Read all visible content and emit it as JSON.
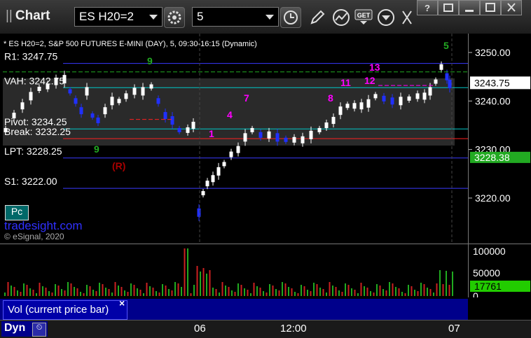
{
  "toolbar": {
    "app_title": "Chart",
    "symbol": "ES H20=2",
    "interval": "5"
  },
  "chart": {
    "description": "* ES H20=2, S&P 500 FUTURES E-MINI (DAY), 5, 09:30-16:15 (Dynamic)",
    "watermark": "tradesight.com",
    "copyright": "© eSignal, 2020",
    "pc_button": "Pc",
    "levels": [
      {
        "label": "R1: 3247.75",
        "price": 3247.75,
        "color": "#3a3aff"
      },
      {
        "label": "VAH: 3242.75",
        "price": 3242.75,
        "color": "#00c8c8"
      },
      {
        "label": "Pivot: 3234.25",
        "price": 3234.25,
        "color": "#00c8c8"
      },
      {
        "label": "Break: 3232.25",
        "price": 3232.25,
        "color": "#ff2020"
      },
      {
        "label": "LPT: 3228.25",
        "price": 3228.25,
        "color": "#3a3aff"
      },
      {
        "label": "S1: 3222.00",
        "price": 3222.0,
        "color": "#3a3aff"
      }
    ],
    "r_marker": "(R)",
    "last_price": "3243.75",
    "lpt_tag": "3228.38"
  },
  "price_axis": {
    "ticks": [
      "3250.00",
      "3240.00",
      "3230.00",
      "3220.00"
    ]
  },
  "volume": {
    "panel_label": "Vol (current price bar)",
    "ticks": [
      "100000",
      "50000",
      "0"
    ],
    "last_volume": "17761"
  },
  "time_axis": {
    "labels": [
      "06",
      "12:00",
      "07"
    ],
    "corner_label": "Dyn"
  },
  "colors": {
    "up": "#ffffff",
    "down": "#2030ff",
    "count_green": "#22aa22",
    "count_magenta": "#ff00ff"
  }
}
